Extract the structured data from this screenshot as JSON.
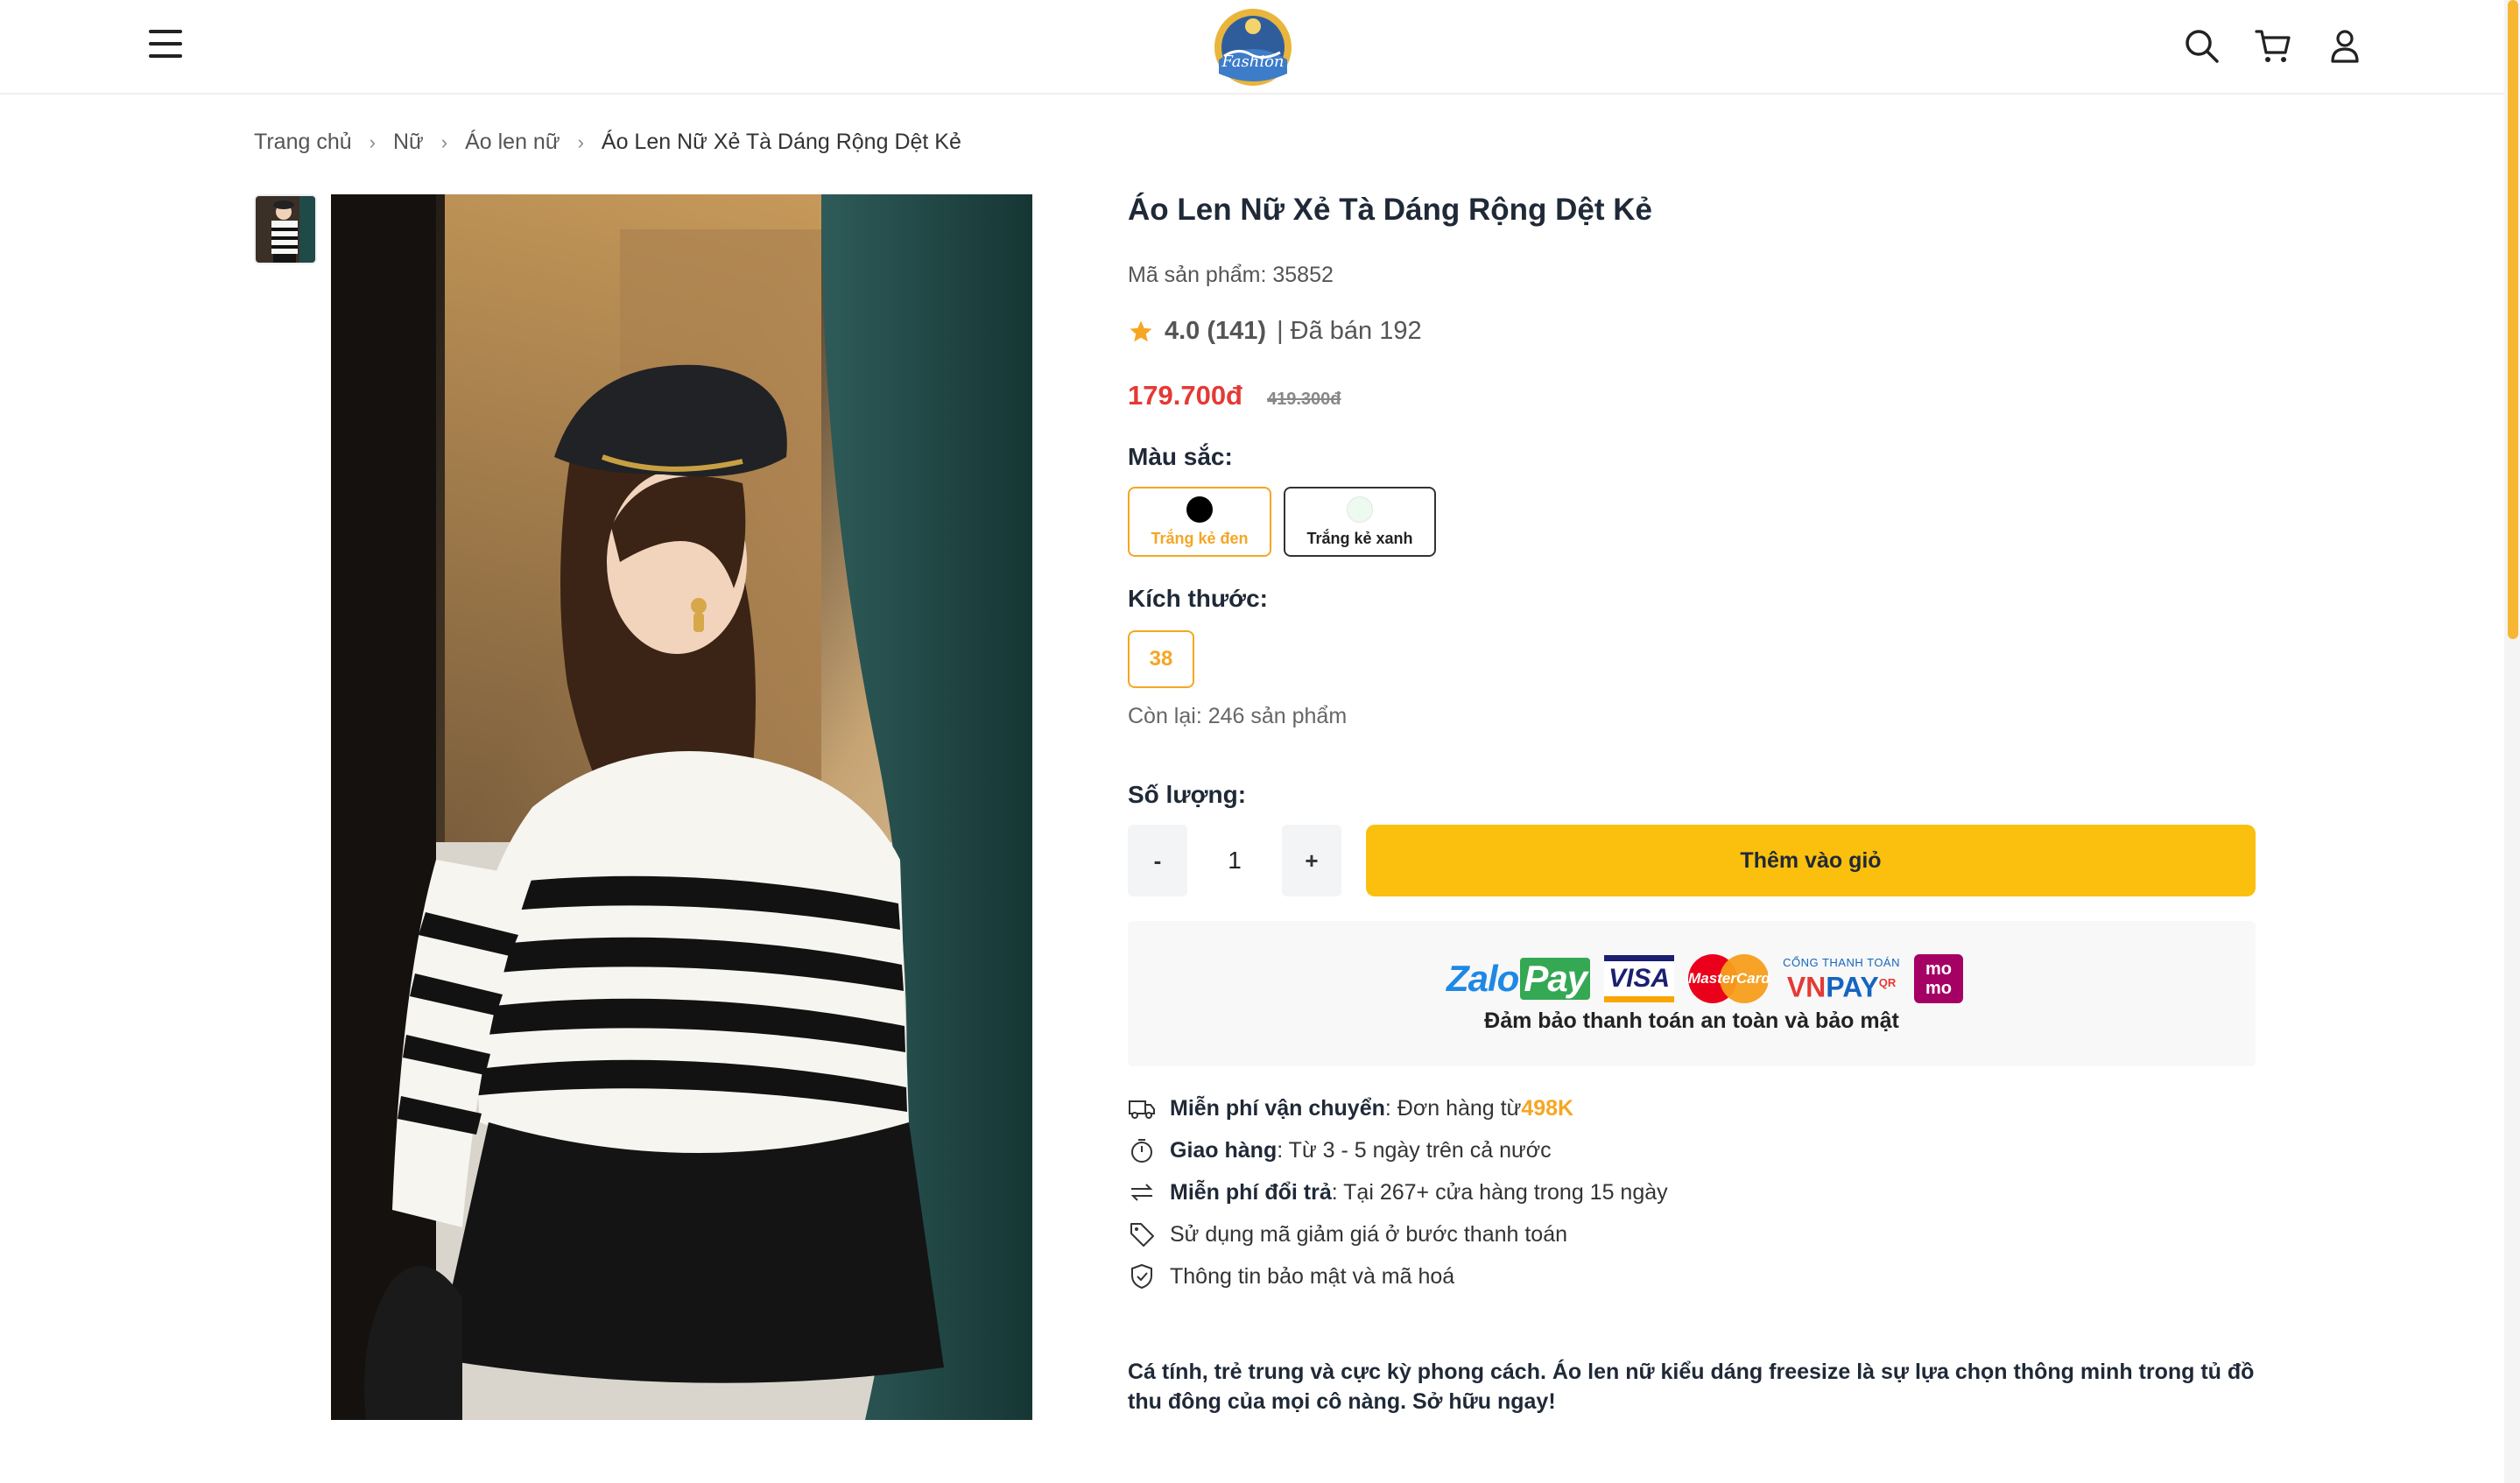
{
  "header": {
    "logo_alt": "Fashion logo",
    "icons": [
      "menu-icon",
      "search-icon",
      "cart-icon",
      "user-icon"
    ]
  },
  "breadcrumb": [
    "Trang chủ",
    "Nữ",
    "Áo len nữ",
    "Áo Len Nữ Xẻ Tà Dáng Rộng Dệt Kẻ"
  ],
  "product": {
    "title": "Áo Len Nữ Xẻ Tà Dáng Rộng Dệt Kẻ",
    "sku": "Mã sản phẩm: 35852",
    "rating": "4.0 (141)",
    "sold": "| Đã bán 192",
    "price": "179.700đ",
    "old_price": "419.300đ",
    "color_label": "Màu sắc:",
    "colors": [
      {
        "name": "Trắng kẻ đen",
        "swatch": "#000000",
        "selected": true
      },
      {
        "name": "Trắng kẻ xanh",
        "swatch": "#eefaf0",
        "selected": false
      }
    ],
    "size_label": "Kích thước:",
    "sizes": [
      "38"
    ],
    "stock": "Còn lại: 246 sản phẩm",
    "qty_label": "Số lượng:",
    "qty_minus": "-",
    "qty_value": "1",
    "qty_plus": "+",
    "add_to_cart": "Thêm vào giỏ"
  },
  "payment": {
    "zalo": "Zalo",
    "zalo_pay": "Pay",
    "visa": "VISA",
    "mastercard": "MasterCard",
    "vnpay_small": "CỔNG THANH TOÁN",
    "vnpay_vn": "VN",
    "vnpay_pay": "PAY",
    "vnpay_qr": "QR",
    "momo": "mo mo",
    "note": "Đảm bảo thanh toán an toàn và bảo mật"
  },
  "perks": [
    {
      "icon": "truck-icon",
      "bold": "Miễn phí vận chuyển",
      "text": ": Đơn hàng từ ",
      "highlight": "498K"
    },
    {
      "icon": "timer-icon",
      "bold": "Giao hàng",
      "text": ": Từ 3 - 5 ngày trên cả nước",
      "highlight": ""
    },
    {
      "icon": "exchange-icon",
      "bold": "Miễn phí đổi trả",
      "text": ": Tại 267+ cửa hàng trong 15 ngày",
      "highlight": ""
    },
    {
      "icon": "tag-icon",
      "bold": "",
      "text": "Sử dụng mã giảm giá ở bước thanh toán",
      "highlight": ""
    },
    {
      "icon": "shield-icon",
      "bold": "",
      "text": "Thông tin bảo mật và mã hoá",
      "highlight": ""
    }
  ],
  "description": "Cá tính, trẻ trung và cực kỳ phong cách. Áo len nữ kiểu dáng freesize là sự lựa chọn thông minh trong tủ đồ thu đông của mọi cô nàng. Sở hữu ngay!",
  "colors": {
    "accent": "#fbbf0e",
    "price": "#e53935",
    "highlight": "#f5a623"
  }
}
